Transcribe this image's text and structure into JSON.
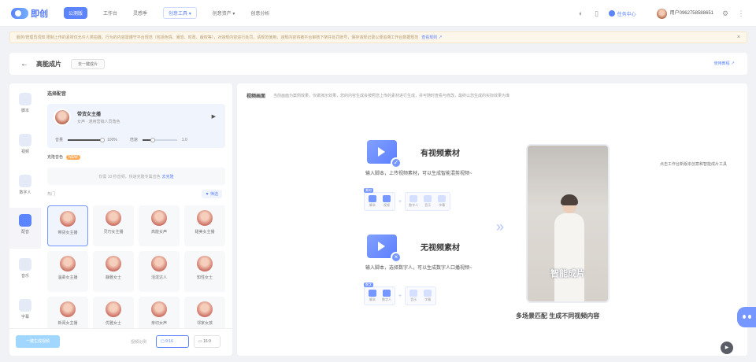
{
  "app": {
    "name": "即创"
  },
  "nav": [
    {
      "label": "公测版"
    },
    {
      "label": "工作台"
    },
    {
      "label": "灵感季"
    },
    {
      "label": "创意工具 ▾"
    },
    {
      "label": "创意资产 ▾"
    },
    {
      "label": "创意分析"
    }
  ],
  "topbar": {
    "task_label": "任务中心",
    "user_name": "用户0962758588651",
    "user_sub": ""
  },
  "banner": {
    "text": "服务/管理员须知  限制上传的素材仅允许人类拍摄，行为的内容需遵守平台规范（包括色情、暴恐、时政、版权等），对违规内容进行处罚，请规范使用，违规内容将被平台审核下架并处罚账号，保存违规记录以便追溯工作台数据规范",
    "link": "查看规则 ↗"
  },
  "title_bar": {
    "back": "←",
    "title": "高能成片",
    "sub_tab": "去一键成片",
    "tutorial": "使用教程 ↗"
  },
  "sidebar": [
    {
      "label": "脚本"
    },
    {
      "label": "视频"
    },
    {
      "label": "数字人"
    },
    {
      "label": "配音"
    },
    {
      "label": "音乐"
    },
    {
      "label": "字幕"
    }
  ],
  "panel": {
    "title": "选择配音",
    "voice": {
      "name": "带货女主播",
      "desc": "女声 · 通用营销人员角色"
    },
    "volume_label": "音量",
    "volume_value": "100%",
    "volume_fill": 1.0,
    "speed_label": "倍速",
    "speed_value": "1.0",
    "speed_fill": 0.3,
    "bg_music_label": "克隆音色",
    "bg_music_badge": "NEW",
    "upload_hint": "仅需 10 秒音频，快速克隆专属音色",
    "upload_link": "去克隆",
    "filter_label": "热门",
    "filter_btn": "▼ 筛选",
    "voices": [
      {
        "name": "带货女主播",
        "selected": true
      },
      {
        "name": "灵巧女主播"
      },
      {
        "name": "高能女声"
      },
      {
        "name": "甜美女主播"
      },
      {
        "name": "温柔女主播"
      },
      {
        "name": "静雅女士"
      },
      {
        "name": "活泼达人"
      },
      {
        "name": "知性女士"
      },
      {
        "name": "新闻女主播"
      },
      {
        "name": "优雅女士"
      },
      {
        "name": "亲切女声"
      },
      {
        "name": "邻家女孩"
      }
    ]
  },
  "bottom": {
    "generate": "一键生成视频",
    "ratio_label": "视频比例",
    "ratio_on": "▢ 9:16",
    "ratio_off": "▭ 16:9"
  },
  "preview": {
    "title": "视频画面",
    "tip": "当前画面为案例效果，仅做演示效果，您的内容生成会按照您上传的素材进行生成，并可随时查看与修改，最终以您生成的实际效果为准",
    "opt1": {
      "title": "有视频素材",
      "desc": "输入脚本，上传视频素材，可以生成智能混剪视频~",
      "tag": "素材",
      "flow": [
        "脚本",
        "视频",
        "数字人",
        "音乐",
        "字幕"
      ]
    },
    "opt2": {
      "title": "无视频素材",
      "desc": "输入脚本，选择数字人，可以生成数字人口播视频~",
      "tag": "数字",
      "flow": [
        "脚本",
        "数字人",
        "音乐",
        "字幕"
      ]
    },
    "phone_caption": "智能成片",
    "scene": "多场景匹配 生成不同视频内容"
  },
  "fab": {
    "tip": "点击工作台新版本创意和智能成片工具"
  },
  "colors": {
    "accent": "#3f6dff",
    "banner_bg": "#fdf5e6",
    "gen_btn": "#8fd0ff"
  }
}
